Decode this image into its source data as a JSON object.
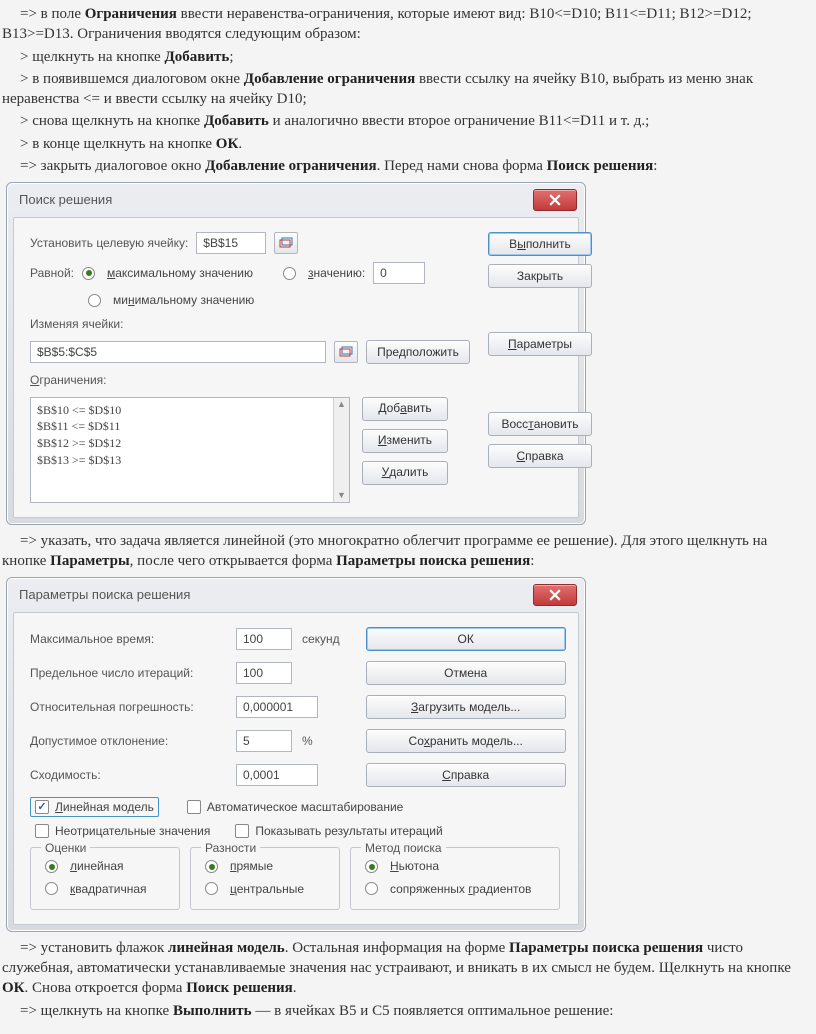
{
  "text": {
    "p1_a": "=> в поле ",
    "p1_b": "Ограничения",
    "p1_c": " ввести неравенства-ограничения, которые имеют вид: B10<=D10; B11<=D11; B12>=D12; B13>=D13. Ограничения вводятся следующим образом:",
    "p2_a": "> щелкнуть на кнопке ",
    "p2_b": "Добавить",
    "p2_c": ";",
    "p3_a": "> в появившемся диалоговом окне ",
    "p3_b": "Добавление ограничения",
    "p3_c": " ввести ссылку на ячейку B10, выбрать из меню знак неравенства <= и ввести ссылку на ячейку D10;",
    "p4_a": "> снова щелкнуть на кнопке ",
    "p4_b": "Добавить",
    "p4_c": " и аналогично ввести второе ограничение B11<=D11 и т. д.;",
    "p5_a": "> в конце щелкнуть на кнопке ",
    "p5_b": "ОК",
    "p5_c": ".",
    "p6_a": "=> закрыть диалоговое окно ",
    "p6_b": "Добавление ограничения",
    "p6_c": ". Перед нами снова форма ",
    "p6_d": "Поиск решения",
    "p6_e": ":",
    "p7_a": "=> указать, что задача является линейной (это многократно облегчит программе ее решение). Для этого щелкнуть на кнопке ",
    "p7_b": "Параметры",
    "p7_c": ", после чего открывается форма ",
    "p7_d": "Параметры поиска решения",
    "p7_e": ":",
    "p8_a": "=> установить флажок ",
    "p8_b": "линейная модель",
    "p8_c": ". Остальная информация на форме ",
    "p8_d": "Параметры поиска решения",
    "p8_e": " чисто служебная, автоматически устанавливаемые значения нас устраивают, и вникать в их смысл не будем. Щелкнуть на кнопке ",
    "p8_f": "ОК",
    "p8_g": ". Снова откроется форма ",
    "p8_h": "Поиск решения",
    "p8_i": ".",
    "p9_a": "=> щелкнуть на кнопке ",
    "p9_b": "Выполнить",
    "p9_c": " — в ячейках B5 и C5 появляется оптимальное решение:"
  },
  "solver": {
    "title": "Поиск решения",
    "target_label": "Установить целевую ячейку:",
    "target_value": "$B$15",
    "equal_label": "Равной:",
    "radio_max_pre": "м",
    "radio_max_mid": "аксимальному значению",
    "radio_value_pre": "з",
    "radio_value_mid": "начению:",
    "radio_value_val": "0",
    "radio_min_pre": "ми",
    "radio_min_hot": "н",
    "radio_min_post": "имальному значению",
    "changing_label": "Изменяя ячейки:",
    "changing_value": "$B$5:$C$5",
    "predict": "Предположить",
    "constraints_label_pre": "",
    "constraints_hot": "О",
    "constraints_label": "граничения:",
    "c1": "$B$10 <= $D$10",
    "c2": "$B$11 <= $D$11",
    "c3": "$B$12 >= $D$12",
    "c4": "$B$13 >= $D$13",
    "add_pre": "Доб",
    "add_hot": "а",
    "add_post": "вить",
    "edit_pre": "",
    "edit_hot": "И",
    "edit_post": "зменить",
    "del_pre": "",
    "del_hot": "У",
    "del_post": "далить",
    "run_pre": "В",
    "run_hot": "ы",
    "run_post": "полнить",
    "close": "Закрыть",
    "params_pre": "",
    "params_hot": "П",
    "params_post": "араметры",
    "restore_pre": "Восс",
    "restore_hot": "т",
    "restore_post": "ановить",
    "help_pre": "",
    "help_hot": "С",
    "help_post": "правка"
  },
  "params": {
    "title": "Параметры поиска решения",
    "max_time_label": "Максимальное время:",
    "max_time_value": "100",
    "seconds": "секунд",
    "iter_label": "Предельное число итераций:",
    "iter_value": "100",
    "prec_label": "Относительная погрешность:",
    "prec_value": "0,000001",
    "tol_label": "Допустимое отклонение:",
    "tol_value": "5",
    "percent": "%",
    "conv_label": "Сходимость:",
    "conv_value": "0,0001",
    "ok": "ОК",
    "cancel": "Отмена",
    "load_pre": "",
    "load_hot": "З",
    "load_post": "агрузить модель...",
    "save_pre": "Со",
    "save_hot": "х",
    "save_post": "ранить модель...",
    "help_pre": "",
    "help_hot": "С",
    "help_post": "правка",
    "chk_linear_pre": "",
    "chk_linear_hot": "Л",
    "chk_linear_post": "инейная модель",
    "chk_auto": "Автоматическое масштабирование",
    "chk_nonneg": "Неотрицательные значения",
    "chk_showiter": "Показывать результаты итераций",
    "grp_est": "Оценки",
    "est_lin_pre": "",
    "est_lin_hot": "л",
    "est_lin_post": "инейная",
    "est_quad_pre": "",
    "est_quad_hot": "к",
    "est_quad_post": "вадратичная",
    "grp_diff": "Разности",
    "diff_fwd_pre": "",
    "diff_fwd_hot": "п",
    "diff_fwd_post": "рямые",
    "diff_cen_pre": "",
    "diff_cen_hot": "ц",
    "diff_cen_post": "ентральные",
    "grp_method": "Метод поиска",
    "m_newton_pre": "",
    "m_newton_hot": "Н",
    "m_newton_post": "ьютона",
    "m_conj_pre": "сопряженных ",
    "m_conj_hot": "г",
    "m_conj_post": "радиентов"
  }
}
